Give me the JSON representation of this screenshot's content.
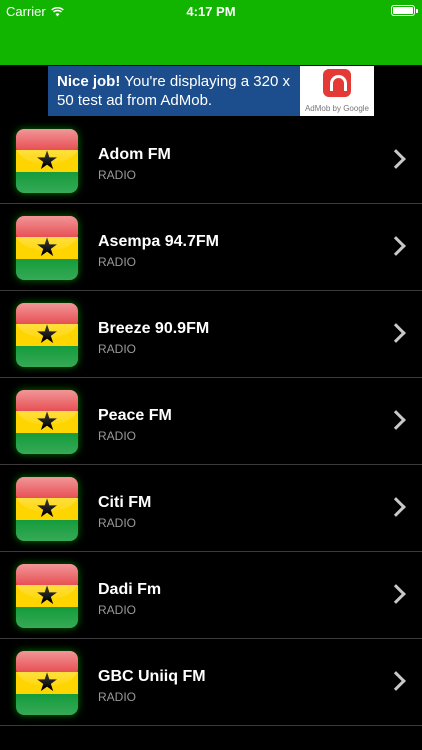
{
  "status": {
    "carrier": "Carrier",
    "time": "4:17 PM"
  },
  "ad": {
    "bold": "Nice job!",
    "text": " You're displaying a 320 x 50 test ad from AdMob.",
    "brand": "AdMob by Google"
  },
  "stations": [
    {
      "name": "Adom FM",
      "type": "RADIO"
    },
    {
      "name": "Asempa 94.7FM",
      "type": "RADIO"
    },
    {
      "name": "Breeze 90.9FM",
      "type": "RADIO"
    },
    {
      "name": "Peace FM",
      "type": "RADIO"
    },
    {
      "name": "Citi FM",
      "type": "RADIO"
    },
    {
      "name": "Dadi Fm",
      "type": "RADIO"
    },
    {
      "name": "GBC Uniiq FM",
      "type": "RADIO"
    }
  ],
  "colors": {
    "accent": "#11b500",
    "flag_red": "#e0161b",
    "flag_yellow": "#ffd500",
    "flag_green": "#139b3a"
  },
  "icons": {
    "row_icon": "ghana-flag-icon",
    "disclosure": "chevron-right-icon"
  }
}
